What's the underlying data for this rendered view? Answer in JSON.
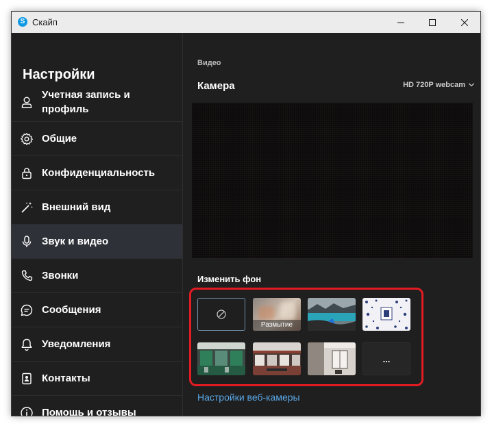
{
  "window": {
    "title": "Скайп",
    "logo_letter": "S"
  },
  "sidebar": {
    "heading": "Настройки",
    "items": [
      {
        "label": "Учетная запись и профиль",
        "icon": "person-icon"
      },
      {
        "label": "Общие",
        "icon": "gear-icon"
      },
      {
        "label": "Конфиденциальность",
        "icon": "lock-icon"
      },
      {
        "label": "Внешний вид",
        "icon": "magic-wand-icon"
      },
      {
        "label": "Звук и видео",
        "icon": "microphone-icon",
        "active": true
      },
      {
        "label": "Звонки",
        "icon": "phone-icon"
      },
      {
        "label": "Сообщения",
        "icon": "chat-bubble-icon"
      },
      {
        "label": "Уведомления",
        "icon": "bell-icon"
      },
      {
        "label": "Контакты",
        "icon": "contact-book-icon"
      },
      {
        "label": "Помощь и отзывы",
        "icon": "info-icon"
      }
    ]
  },
  "main": {
    "section_label": "Видео",
    "camera_label": "Камера",
    "camera_device": "HD 720P webcam",
    "background_label": "Изменить фон",
    "backgrounds": [
      {
        "name": "none",
        "icon": "no-background-icon"
      },
      {
        "name": "blur",
        "caption": "Размытие"
      },
      {
        "name": "mountain-lake"
      },
      {
        "name": "winter-pattern"
      },
      {
        "name": "green-office"
      },
      {
        "name": "red-hall"
      },
      {
        "name": "white-room"
      },
      {
        "name": "more",
        "label": "..."
      }
    ],
    "webcam_settings_link": "Настройки веб-камеры"
  },
  "colors": {
    "window_bg": "#1f1f1f",
    "active_item_bg": "#2e3138",
    "link": "#5ba9e8",
    "highlight": "#e31b22"
  }
}
